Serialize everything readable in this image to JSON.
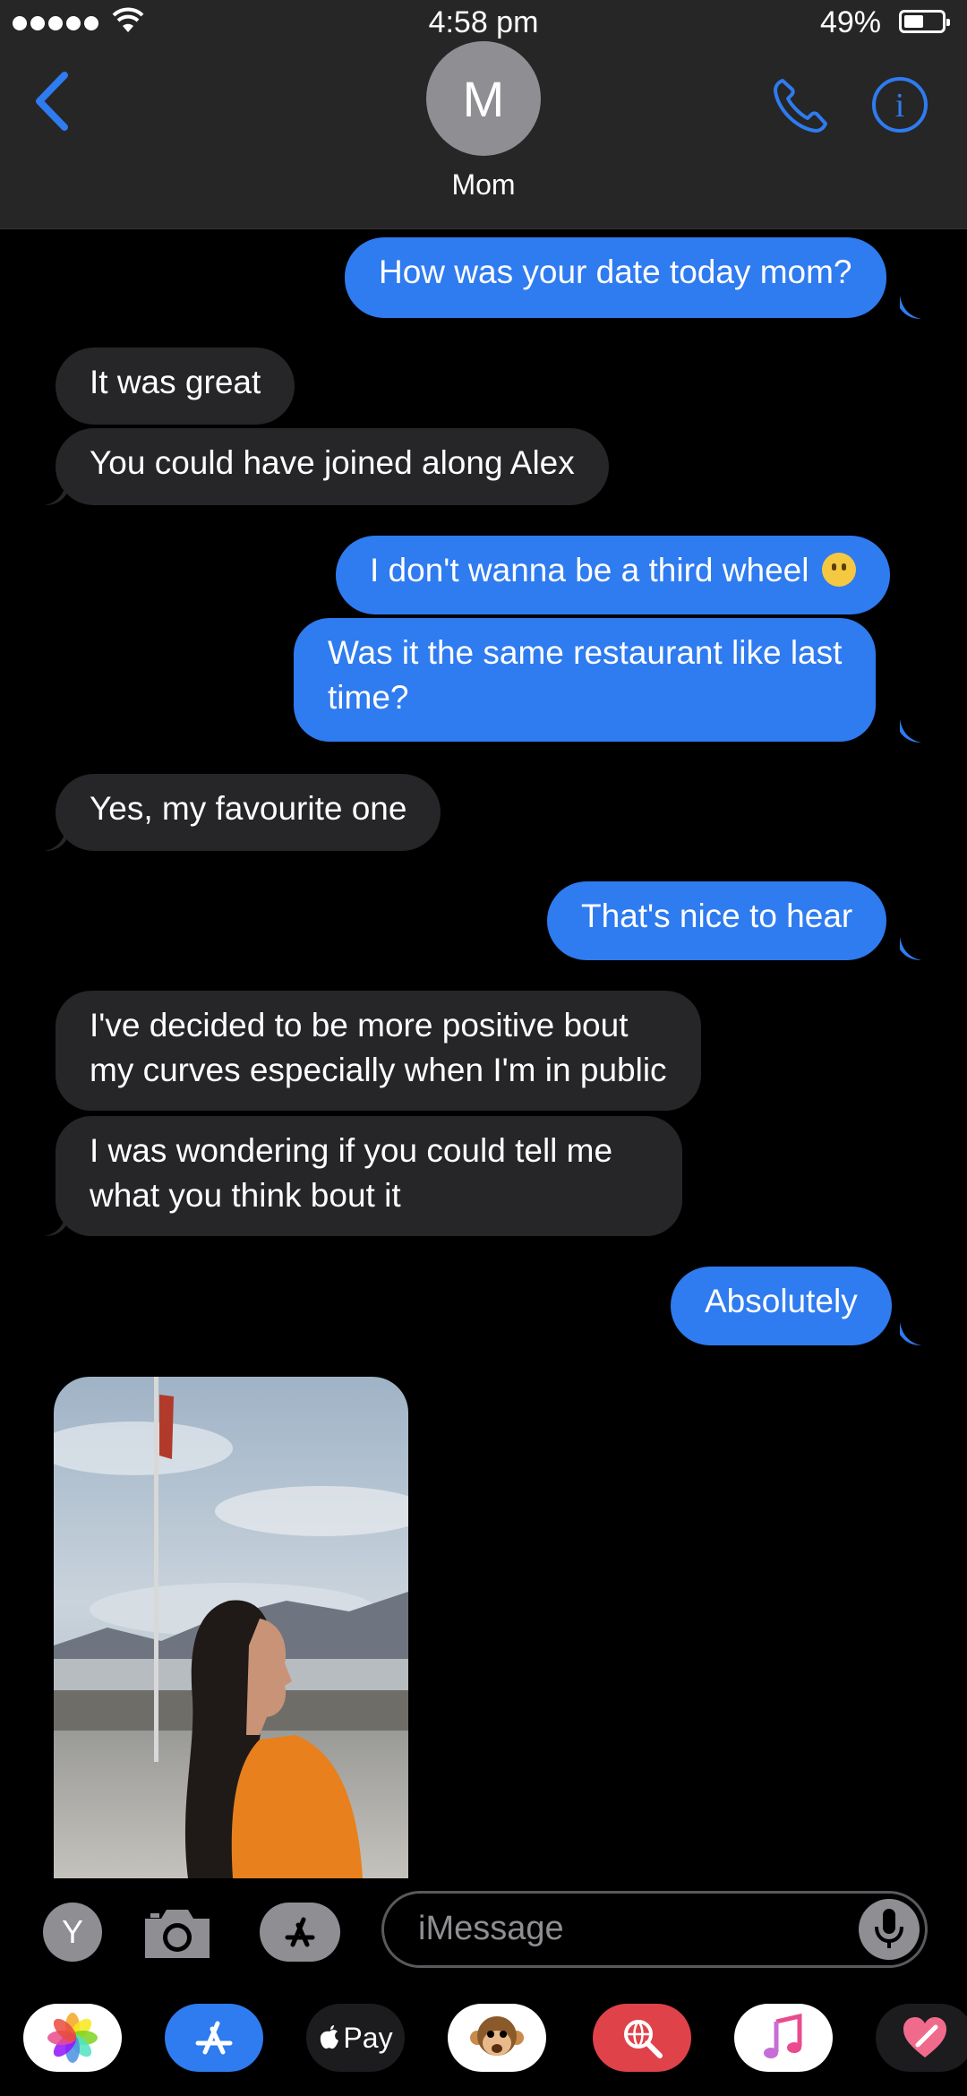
{
  "status_bar": {
    "time": "4:58 pm",
    "battery_percent": "49%",
    "battery_level": 0.49
  },
  "header": {
    "avatar_initial": "M",
    "contact_name": "Mom"
  },
  "messages": [
    {
      "side": "outgoing",
      "text": "How was your date today mom?"
    },
    {
      "side": "incoming",
      "text": "It was great"
    },
    {
      "side": "incoming",
      "text": "You could have joined along Alex"
    },
    {
      "side": "outgoing",
      "text": "I don't wanna be a third wheel",
      "emoji": "no-mouth-face"
    },
    {
      "side": "outgoing",
      "text_line1": "Was it the same restaurant like last",
      "text_line2": "time?"
    },
    {
      "side": "incoming",
      "text": "Yes, my favourite one"
    },
    {
      "side": "outgoing",
      "text": "That's nice to hear"
    },
    {
      "side": "incoming",
      "text_line1": "I've decided to be more positive bout",
      "text_line2": "my curves especially when I'm in public"
    },
    {
      "side": "incoming",
      "text_line1": "I was wondering if you could tell me",
      "text_line2": "what you think bout it"
    },
    {
      "side": "outgoing",
      "text": "Absolutely"
    },
    {
      "side": "incoming",
      "type": "photo"
    }
  ],
  "input_bar": {
    "left_button_label": "Y",
    "placeholder": "iMessage"
  },
  "app_drawer": [
    {
      "name": "photos",
      "icon": "photos-icon"
    },
    {
      "name": "app-store",
      "icon": "app-store-icon"
    },
    {
      "name": "apple-pay",
      "label": "Pay",
      "icon": "apple-pay-icon"
    },
    {
      "name": "animoji",
      "icon": "monkey-icon"
    },
    {
      "name": "images-search",
      "icon": "globe-search-icon"
    },
    {
      "name": "music",
      "icon": "music-note-icon"
    },
    {
      "name": "digital-touch",
      "icon": "heart-icon"
    }
  ],
  "colors": {
    "outgoing_bubble": "#2f7bf0",
    "incoming_bubble": "#262629",
    "accent": "#2f7bf0",
    "header_bg": "#262626"
  }
}
